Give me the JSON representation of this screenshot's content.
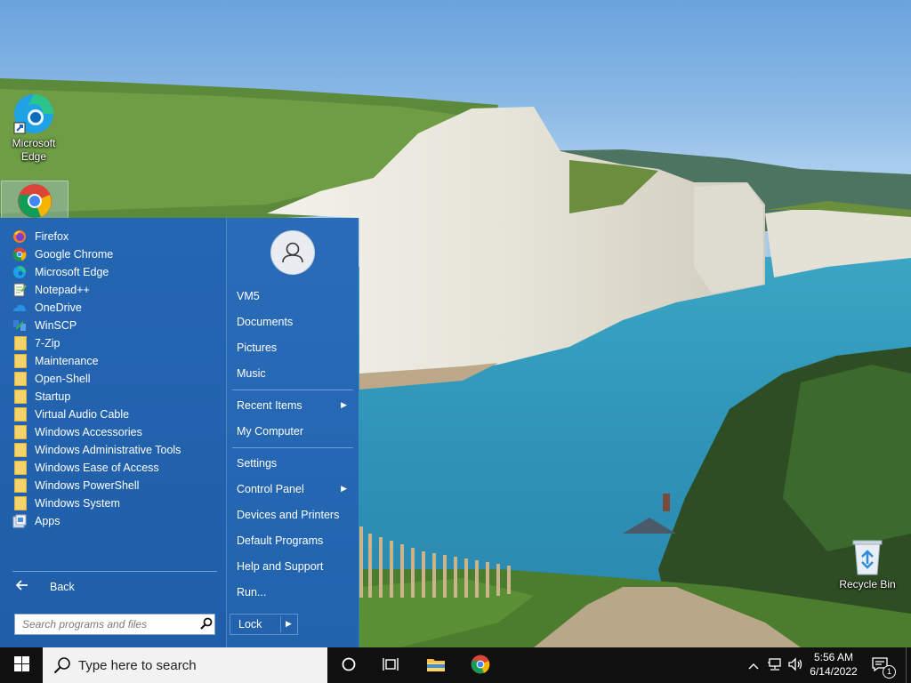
{
  "desktop": {
    "icons": [
      {
        "label_line1": "Microsoft",
        "label_line2": "Edge",
        "icon": "edge-icon"
      },
      {
        "label_line1": "",
        "label_line2": "",
        "icon": "chrome-icon"
      },
      {
        "label_line1": "Recycle Bin",
        "label_line2": "",
        "icon": "recycle-bin-icon"
      }
    ]
  },
  "start_menu": {
    "programs": [
      {
        "label": "Firefox",
        "icon": "firefox-icon"
      },
      {
        "label": "Google Chrome",
        "icon": "chrome-icon"
      },
      {
        "label": "Microsoft Edge",
        "icon": "edge-icon"
      },
      {
        "label": "Notepad++",
        "icon": "notepadpp-icon"
      },
      {
        "label": "OneDrive",
        "icon": "onedrive-icon"
      },
      {
        "label": "WinSCP",
        "icon": "winscp-icon"
      },
      {
        "label": "7-Zip",
        "icon": "folder-icon"
      },
      {
        "label": "Maintenance",
        "icon": "folder-icon"
      },
      {
        "label": "Open-Shell",
        "icon": "folder-icon"
      },
      {
        "label": "Startup",
        "icon": "folder-icon"
      },
      {
        "label": "Virtual Audio Cable",
        "icon": "folder-icon"
      },
      {
        "label": "Windows Accessories",
        "icon": "folder-icon"
      },
      {
        "label": "Windows Administrative Tools",
        "icon": "folder-icon"
      },
      {
        "label": "Windows Ease of Access",
        "icon": "folder-icon"
      },
      {
        "label": "Windows PowerShell",
        "icon": "folder-icon"
      },
      {
        "label": "Windows System",
        "icon": "folder-icon"
      },
      {
        "label": "Apps",
        "icon": "apps-icon"
      }
    ],
    "back_label": "Back",
    "search_placeholder": "Search programs and files",
    "user_name": "VM5",
    "right_items": [
      {
        "label": "Documents"
      },
      {
        "label": "Pictures"
      },
      {
        "label": "Music"
      },
      {
        "label": "Recent Items",
        "submenu": true
      },
      {
        "label": "My Computer"
      },
      {
        "label": "Settings"
      },
      {
        "label": "Control Panel",
        "submenu": true
      },
      {
        "label": "Devices and Printers"
      },
      {
        "label": "Default Programs"
      },
      {
        "label": "Help and Support"
      },
      {
        "label": "Run..."
      }
    ],
    "lock_label": "Lock"
  },
  "taskbar": {
    "search_placeholder": "Type here to search",
    "pinned": [
      "cortana-icon",
      "task-view-icon",
      "file-explorer-icon",
      "chrome-icon"
    ],
    "tray_icons": [
      "chevron-up-icon",
      "network-icon",
      "volume-icon"
    ],
    "time": "5:56 AM",
    "date": "6/14/2022",
    "notification_count": "1"
  },
  "colors": {
    "start_menu_bg": "#1f5ea6",
    "taskbar_bg": "#101010"
  }
}
